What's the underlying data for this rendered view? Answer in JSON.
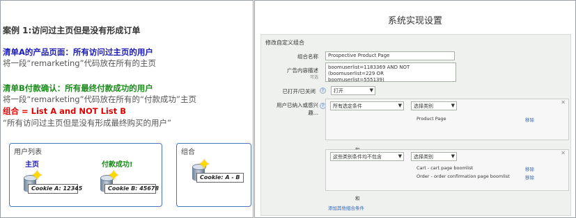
{
  "left": {
    "case_title": "案例 1:访问过主页但是没有形成订单",
    "list_a_title": "清单A的产品页面：所有访问过主页的用户",
    "list_a_desc": "将一段“remarketing”代码放在所有的主页",
    "list_b_title": "清单B付款确认：所有最终付款成功的用户",
    "list_b_desc": "将一段“remarketing”代码放在所有的“付款成功”主页",
    "combo_title": "组合 = List A and NOT List B",
    "combo_desc": "“所有访问过主页但是没有形成最终购买的用户”",
    "user_list_box": {
      "title": "用户列表",
      "home_label": "主页",
      "paid_label": "付款成功!",
      "cookie_a": "Cookie A: 12345",
      "cookie_b": "Cookie B: 45678"
    },
    "combo_box": {
      "title": "组合",
      "cookie": "Cookie: A - B"
    }
  },
  "right": {
    "title": "系统实现设置",
    "form_heading": "修改自定义组合",
    "name_label": "组合名称",
    "name_value": "Prospective Product Page",
    "desc_label": "广告内容描述",
    "desc_hint": "可选",
    "desc_value_line1": "boomuserlist=1183369 AND NOT (boomuserlist=229 OR",
    "desc_value_line2": "boomuserlist=555139)",
    "status_label": "已打开/已关闭",
    "status_value": "打开",
    "users_label_line1": "用户已纳入或感兴",
    "users_label_line2": "趣...",
    "group1": {
      "condition": "所有选定条件",
      "select_label": "选择类别",
      "items": [
        {
          "name": "Product Page",
          "action": "移除"
        }
      ]
    },
    "and_text_1": "和",
    "group2": {
      "condition": "这些类别条件均不包含",
      "select_label": "选择类别",
      "items": [
        {
          "name": "Cart - cart page boomlist",
          "action": "移除"
        },
        {
          "name": "Order - order confirmation page boomlist",
          "action": "移除"
        }
      ]
    },
    "and_text_2": "和",
    "add_link": "添加其他组合条件"
  }
}
